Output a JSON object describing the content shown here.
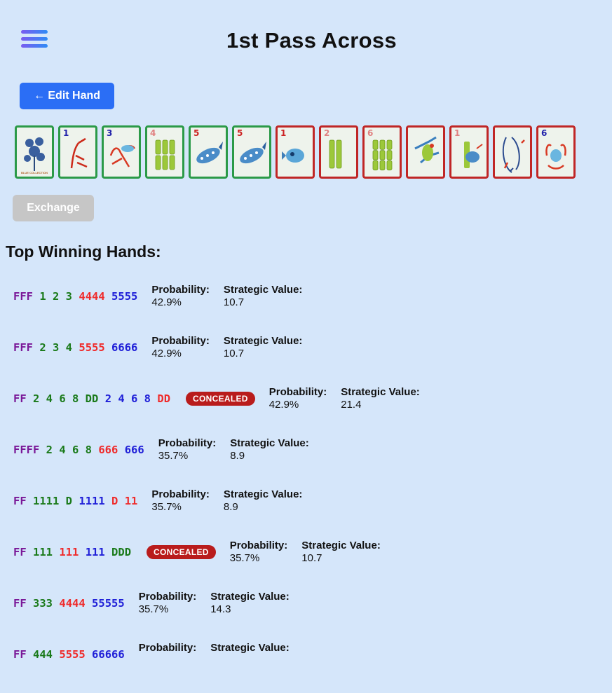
{
  "header": {
    "title": "1st Pass Across",
    "menu_icon": "hamburger-menu-icon"
  },
  "edit_button": {
    "label": "← Edit Hand"
  },
  "tiles": [
    {
      "name": "flower",
      "number": "",
      "caption": "BLUE COLLECTION",
      "status": "keep"
    },
    {
      "name": "1-crak",
      "number": "1",
      "numColor": "#2222aa",
      "status": "keep"
    },
    {
      "name": "3-crak",
      "number": "3",
      "numColor": "#2222aa",
      "status": "keep"
    },
    {
      "name": "4-bam",
      "number": "4",
      "numColor": "#e08080",
      "status": "keep"
    },
    {
      "name": "5-dot",
      "number": "5",
      "numColor": "#cc2222",
      "status": "keep"
    },
    {
      "name": "5-dot",
      "number": "5",
      "numColor": "#cc2222",
      "status": "keep"
    },
    {
      "name": "1-dot",
      "number": "1",
      "numColor": "#cc2222",
      "status": "pass"
    },
    {
      "name": "2-bam",
      "number": "2",
      "numColor": "#e08080",
      "status": "pass"
    },
    {
      "name": "6-bam",
      "number": "6",
      "numColor": "#e08080",
      "status": "pass"
    },
    {
      "name": "1-bam-bird",
      "number": "",
      "status": "pass"
    },
    {
      "name": "1-bam",
      "number": "1",
      "numColor": "#e08080",
      "status": "pass"
    },
    {
      "name": "dragon",
      "number": "",
      "status": "pass"
    },
    {
      "name": "6-crak",
      "number": "6",
      "numColor": "#2222aa",
      "status": "pass"
    }
  ],
  "exchange_button": {
    "label": "Exchange"
  },
  "section_title": "Top Winning Hands:",
  "labels": {
    "probability": "Probability:",
    "strategic_value": "Strategic Value:"
  },
  "colors": {
    "purple": "#7a1898",
    "green": "#1a7a1a",
    "red": "#ef2b2b",
    "blue": "#2020d8",
    "badge": "#b91c1c",
    "keep": "#2b9a48",
    "pass": "#c02626"
  },
  "hands": [
    {
      "segments": [
        {
          "t": "FFF",
          "c": "purple"
        },
        {
          "t": "1 2 3",
          "c": "green"
        },
        {
          "t": "4444",
          "c": "red"
        },
        {
          "t": "5555",
          "c": "blue"
        }
      ],
      "concealed": false,
      "probability": "42.9%",
      "value": "10.7"
    },
    {
      "segments": [
        {
          "t": "FFF",
          "c": "purple"
        },
        {
          "t": "2 3 4",
          "c": "green"
        },
        {
          "t": "5555",
          "c": "red"
        },
        {
          "t": "6666",
          "c": "blue"
        }
      ],
      "concealed": false,
      "probability": "42.9%",
      "value": "10.7"
    },
    {
      "segments": [
        {
          "t": "FF",
          "c": "purple"
        },
        {
          "t": "2 4 6 8 DD",
          "c": "green"
        },
        {
          "t": "2 4 6 8",
          "c": "blue"
        },
        {
          "t": "DD",
          "c": "red"
        }
      ],
      "concealed": true,
      "probability": "42.9%",
      "value": "21.4"
    },
    {
      "segments": [
        {
          "t": "FFFF",
          "c": "purple"
        },
        {
          "t": "2 4 6 8",
          "c": "green"
        },
        {
          "t": "666",
          "c": "red"
        },
        {
          "t": "666",
          "c": "blue"
        }
      ],
      "concealed": false,
      "probability": "35.7%",
      "value": "8.9"
    },
    {
      "segments": [
        {
          "t": "FF",
          "c": "purple"
        },
        {
          "t": "1111 D",
          "c": "green"
        },
        {
          "t": "1111",
          "c": "blue"
        },
        {
          "t": "D 11",
          "c": "red"
        }
      ],
      "concealed": false,
      "probability": "35.7%",
      "value": "8.9"
    },
    {
      "segments": [
        {
          "t": "FF",
          "c": "purple"
        },
        {
          "t": "111",
          "c": "green"
        },
        {
          "t": "111",
          "c": "red"
        },
        {
          "t": "111",
          "c": "blue"
        },
        {
          "t": "DDD",
          "c": "green"
        }
      ],
      "concealed": true,
      "probability": "35.7%",
      "value": "10.7"
    },
    {
      "segments": [
        {
          "t": "FF",
          "c": "purple"
        },
        {
          "t": "333",
          "c": "green"
        },
        {
          "t": "4444",
          "c": "red"
        },
        {
          "t": "55555",
          "c": "blue"
        }
      ],
      "concealed": false,
      "probability": "35.7%",
      "value": "14.3"
    },
    {
      "segments": [
        {
          "t": "FF",
          "c": "purple"
        },
        {
          "t": "444",
          "c": "green"
        },
        {
          "t": "5555",
          "c": "red"
        },
        {
          "t": "66666",
          "c": "blue"
        }
      ],
      "concealed": false,
      "probability": "",
      "value": ""
    }
  ],
  "badge_label": "CONCEALED"
}
